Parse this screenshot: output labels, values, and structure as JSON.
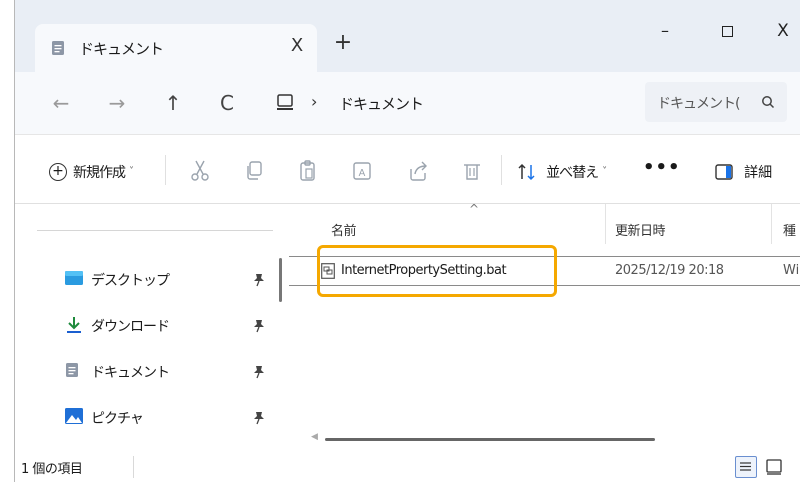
{
  "tab": {
    "title": "ドキュメント",
    "close": "X",
    "new_tab": "+"
  },
  "window_controls": {
    "minimize": "–",
    "close": "X"
  },
  "nav": {
    "back": "←",
    "forward": "→",
    "up": "↑",
    "refresh": "C"
  },
  "address": {
    "separator": "›",
    "crumb": "ドキュメント"
  },
  "search": {
    "placeholder": "ドキュメント(",
    "icon": "search-icon"
  },
  "toolbar": {
    "new_label": "新規作成",
    "new_icon": "+",
    "caret": "˅",
    "sort_label": "並べ替え",
    "more_label": "•••",
    "details_label": "詳細"
  },
  "sidebar": {
    "items": [
      {
        "label": "デスクトップ",
        "icon": "desktop-icon",
        "pinned": true
      },
      {
        "label": "ダウンロード",
        "icon": "download-icon",
        "pinned": true
      },
      {
        "label": "ドキュメント",
        "icon": "document-icon",
        "pinned": true
      },
      {
        "label": "ピクチャ",
        "icon": "pictures-icon",
        "pinned": true
      }
    ]
  },
  "columns": {
    "name": "名前",
    "date": "更新日時",
    "type": "種",
    "sort_indicator": "^"
  },
  "files": [
    {
      "name": "InternetPropertySetting.bat",
      "date": "2025/12/19 20:18",
      "type": "Wi"
    }
  ],
  "status": {
    "item_count": "1 個の項目"
  },
  "colors": {
    "highlight": "#f5a800",
    "accent": "#1a73e8"
  }
}
